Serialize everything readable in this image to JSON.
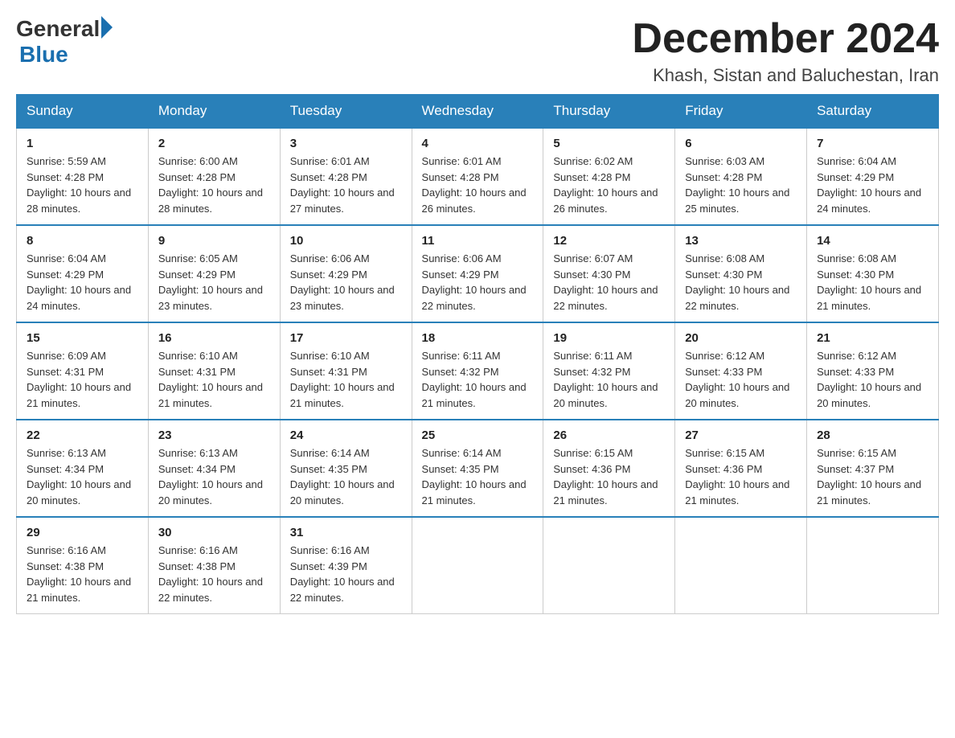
{
  "header": {
    "logo": {
      "general": "General",
      "arrow": "▶",
      "blue": "Blue"
    },
    "title": "December 2024",
    "subtitle": "Khash, Sistan and Baluchestan, Iran"
  },
  "weekdays": [
    "Sunday",
    "Monday",
    "Tuesday",
    "Wednesday",
    "Thursday",
    "Friday",
    "Saturday"
  ],
  "weeks": [
    [
      {
        "day": "1",
        "sunrise": "5:59 AM",
        "sunset": "4:28 PM",
        "daylight": "10 hours and 28 minutes."
      },
      {
        "day": "2",
        "sunrise": "6:00 AM",
        "sunset": "4:28 PM",
        "daylight": "10 hours and 28 minutes."
      },
      {
        "day": "3",
        "sunrise": "6:01 AM",
        "sunset": "4:28 PM",
        "daylight": "10 hours and 27 minutes."
      },
      {
        "day": "4",
        "sunrise": "6:01 AM",
        "sunset": "4:28 PM",
        "daylight": "10 hours and 26 minutes."
      },
      {
        "day": "5",
        "sunrise": "6:02 AM",
        "sunset": "4:28 PM",
        "daylight": "10 hours and 26 minutes."
      },
      {
        "day": "6",
        "sunrise": "6:03 AM",
        "sunset": "4:28 PM",
        "daylight": "10 hours and 25 minutes."
      },
      {
        "day": "7",
        "sunrise": "6:04 AM",
        "sunset": "4:29 PM",
        "daylight": "10 hours and 24 minutes."
      }
    ],
    [
      {
        "day": "8",
        "sunrise": "6:04 AM",
        "sunset": "4:29 PM",
        "daylight": "10 hours and 24 minutes."
      },
      {
        "day": "9",
        "sunrise": "6:05 AM",
        "sunset": "4:29 PM",
        "daylight": "10 hours and 23 minutes."
      },
      {
        "day": "10",
        "sunrise": "6:06 AM",
        "sunset": "4:29 PM",
        "daylight": "10 hours and 23 minutes."
      },
      {
        "day": "11",
        "sunrise": "6:06 AM",
        "sunset": "4:29 PM",
        "daylight": "10 hours and 22 minutes."
      },
      {
        "day": "12",
        "sunrise": "6:07 AM",
        "sunset": "4:30 PM",
        "daylight": "10 hours and 22 minutes."
      },
      {
        "day": "13",
        "sunrise": "6:08 AM",
        "sunset": "4:30 PM",
        "daylight": "10 hours and 22 minutes."
      },
      {
        "day": "14",
        "sunrise": "6:08 AM",
        "sunset": "4:30 PM",
        "daylight": "10 hours and 21 minutes."
      }
    ],
    [
      {
        "day": "15",
        "sunrise": "6:09 AM",
        "sunset": "4:31 PM",
        "daylight": "10 hours and 21 minutes."
      },
      {
        "day": "16",
        "sunrise": "6:10 AM",
        "sunset": "4:31 PM",
        "daylight": "10 hours and 21 minutes."
      },
      {
        "day": "17",
        "sunrise": "6:10 AM",
        "sunset": "4:31 PM",
        "daylight": "10 hours and 21 minutes."
      },
      {
        "day": "18",
        "sunrise": "6:11 AM",
        "sunset": "4:32 PM",
        "daylight": "10 hours and 21 minutes."
      },
      {
        "day": "19",
        "sunrise": "6:11 AM",
        "sunset": "4:32 PM",
        "daylight": "10 hours and 20 minutes."
      },
      {
        "day": "20",
        "sunrise": "6:12 AM",
        "sunset": "4:33 PM",
        "daylight": "10 hours and 20 minutes."
      },
      {
        "day": "21",
        "sunrise": "6:12 AM",
        "sunset": "4:33 PM",
        "daylight": "10 hours and 20 minutes."
      }
    ],
    [
      {
        "day": "22",
        "sunrise": "6:13 AM",
        "sunset": "4:34 PM",
        "daylight": "10 hours and 20 minutes."
      },
      {
        "day": "23",
        "sunrise": "6:13 AM",
        "sunset": "4:34 PM",
        "daylight": "10 hours and 20 minutes."
      },
      {
        "day": "24",
        "sunrise": "6:14 AM",
        "sunset": "4:35 PM",
        "daylight": "10 hours and 20 minutes."
      },
      {
        "day": "25",
        "sunrise": "6:14 AM",
        "sunset": "4:35 PM",
        "daylight": "10 hours and 21 minutes."
      },
      {
        "day": "26",
        "sunrise": "6:15 AM",
        "sunset": "4:36 PM",
        "daylight": "10 hours and 21 minutes."
      },
      {
        "day": "27",
        "sunrise": "6:15 AM",
        "sunset": "4:36 PM",
        "daylight": "10 hours and 21 minutes."
      },
      {
        "day": "28",
        "sunrise": "6:15 AM",
        "sunset": "4:37 PM",
        "daylight": "10 hours and 21 minutes."
      }
    ],
    [
      {
        "day": "29",
        "sunrise": "6:16 AM",
        "sunset": "4:38 PM",
        "daylight": "10 hours and 21 minutes."
      },
      {
        "day": "30",
        "sunrise": "6:16 AM",
        "sunset": "4:38 PM",
        "daylight": "10 hours and 22 minutes."
      },
      {
        "day": "31",
        "sunrise": "6:16 AM",
        "sunset": "4:39 PM",
        "daylight": "10 hours and 22 minutes."
      },
      null,
      null,
      null,
      null
    ]
  ]
}
